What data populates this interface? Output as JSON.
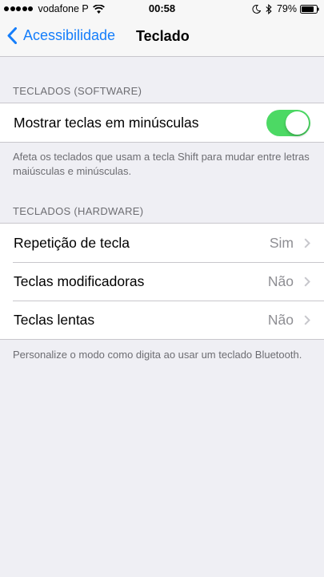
{
  "status_bar": {
    "carrier": "vodafone P",
    "time": "00:58",
    "battery": "79%"
  },
  "nav": {
    "back_label": "Acessibilidade",
    "title": "Teclado"
  },
  "software_section": {
    "header": "TECLADOS (SOFTWARE)",
    "toggle_label": "Mostrar teclas em minúsculas",
    "toggle_on": true,
    "footer": "Afeta os teclados que usam a tecla Shift para mudar entre letras maiúsculas e minúsculas."
  },
  "hardware_section": {
    "header": "TECLADOS (HARDWARE)",
    "rows": [
      {
        "label": "Repetição de tecla",
        "value": "Sim"
      },
      {
        "label": "Teclas modificadoras",
        "value": "Não"
      },
      {
        "label": "Teclas lentas",
        "value": "Não"
      }
    ],
    "footer": "Personalize o modo como digita ao usar um teclado Bluetooth."
  },
  "colors": {
    "accent": "#157efb",
    "toggle_on": "#4cd964",
    "background": "#efeff4"
  }
}
